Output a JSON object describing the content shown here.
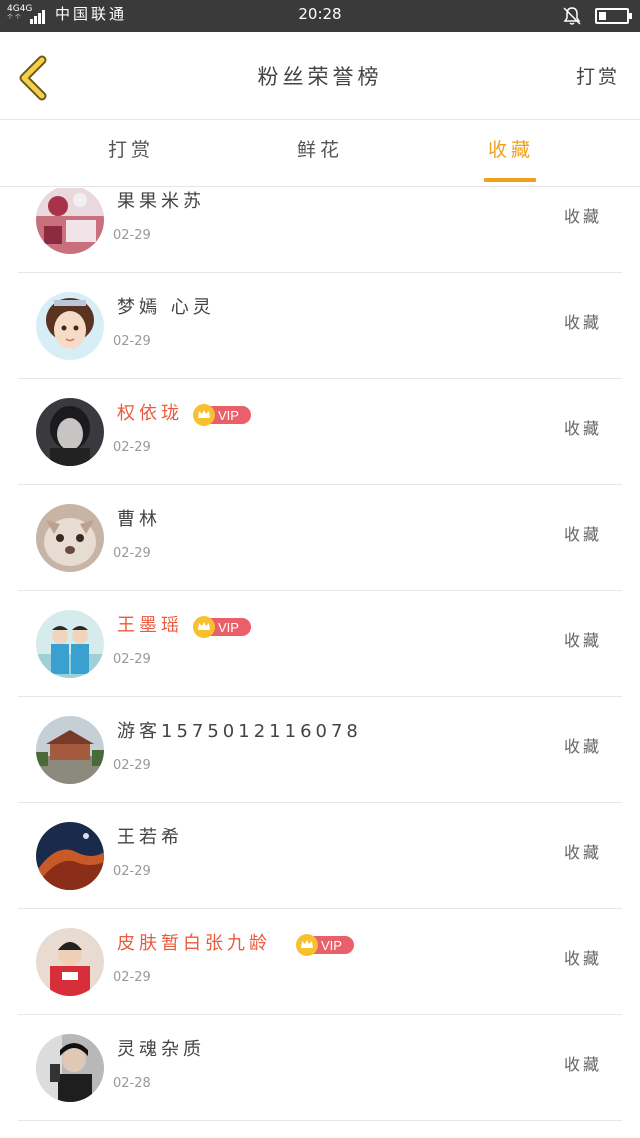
{
  "status_bar": {
    "network": "4G4G",
    "network_sub": "个 个",
    "carrier": "中国联通",
    "time": "20:28",
    "bell_icon": "bell-muted-icon",
    "battery_icon": "battery-icon"
  },
  "header": {
    "back_icon": "chevron-left-icon",
    "title": "粉丝荣誉榜",
    "action": "打赏"
  },
  "tabs": {
    "items": [
      {
        "label": "打赏"
      },
      {
        "label": "鲜花"
      },
      {
        "label": "收藏"
      }
    ],
    "active_index": 2,
    "active_color": "#f0a020"
  },
  "vip_label": "VIP",
  "collect_label": "收藏",
  "list": [
    {
      "name": "果果米苏",
      "date": "02-29",
      "vip": false
    },
    {
      "name": "梦嫣 心灵",
      "date": "02-29",
      "vip": false
    },
    {
      "name": "权依珑",
      "date": "02-29",
      "vip": true
    },
    {
      "name": "曹林",
      "date": "02-29",
      "vip": false
    },
    {
      "name": "王墨瑶",
      "date": "02-29",
      "vip": true
    },
    {
      "name": "游客1575012116078",
      "date": "02-29",
      "vip": false
    },
    {
      "name": "王若希",
      "date": "02-29",
      "vip": false
    },
    {
      "name": "皮肤暂白张九龄",
      "date": "02-29",
      "vip": true
    },
    {
      "name": "灵魂杂质",
      "date": "02-28",
      "vip": false
    }
  ],
  "colors": {
    "accent": "#f0a020",
    "vip_name": "#ec5a3c",
    "vip_badge": "#e9606a",
    "crown": "#f6c02e"
  }
}
